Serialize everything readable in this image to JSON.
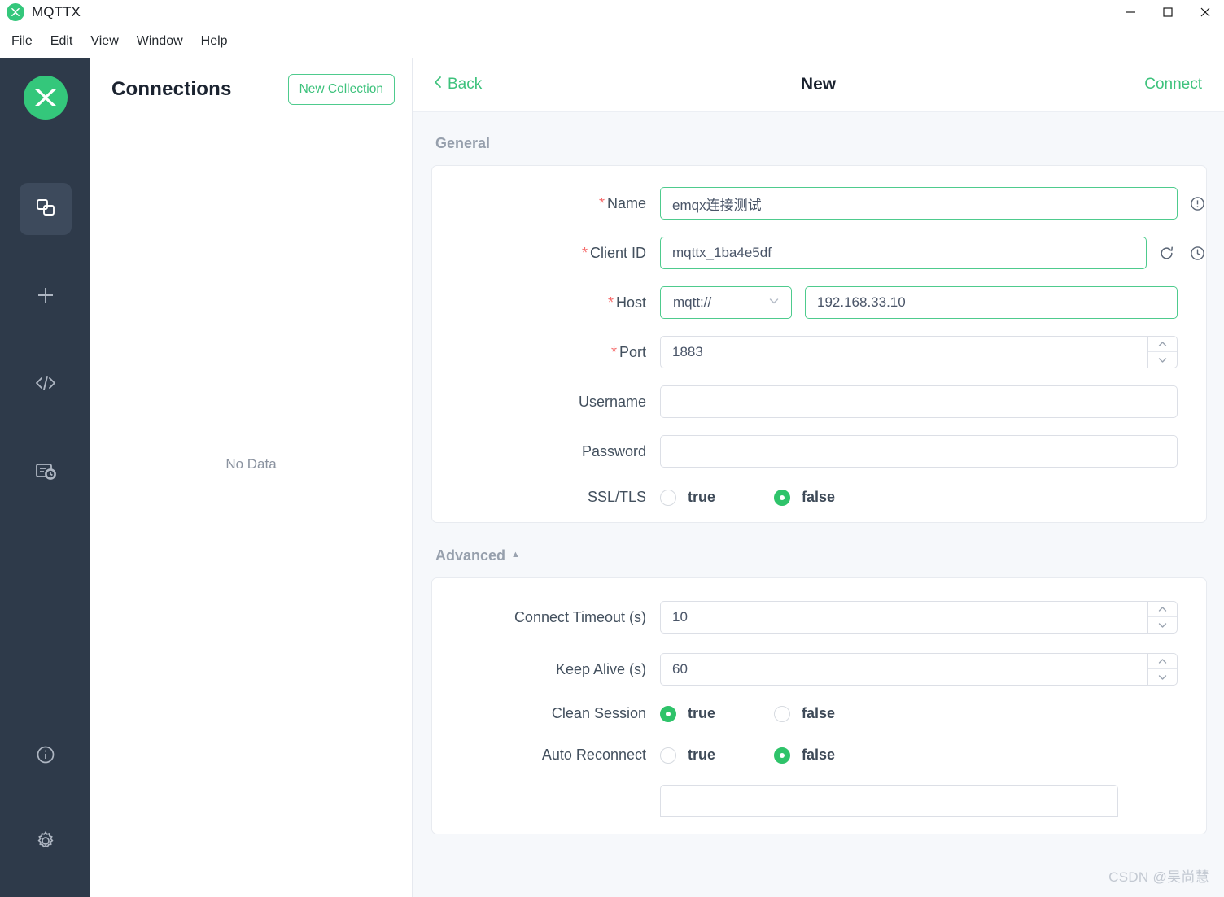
{
  "window": {
    "title": "MQTTX",
    "logo_icon": "mqttx-logo-icon",
    "controls": {
      "minimize": "minimize-icon",
      "maximize": "maximize-icon",
      "close": "close-icon"
    }
  },
  "menubar": {
    "items": [
      {
        "label": "File"
      },
      {
        "label": "Edit"
      },
      {
        "label": "View"
      },
      {
        "label": "Window"
      },
      {
        "label": "Help"
      }
    ]
  },
  "rail": {
    "logo_icon": "mqttx-logo-icon",
    "items": [
      {
        "name": "connections",
        "icon": "connections-icon",
        "active": true
      },
      {
        "name": "new-connection",
        "icon": "plus-icon",
        "active": false
      },
      {
        "name": "scripts",
        "icon": "code-brackets-icon",
        "active": false
      },
      {
        "name": "log",
        "icon": "log-history-icon",
        "active": false
      }
    ],
    "bottom_items": [
      {
        "name": "about",
        "icon": "info-circle-icon"
      },
      {
        "name": "settings",
        "icon": "gear-icon"
      }
    ]
  },
  "connections_panel": {
    "title": "Connections",
    "new_collection_label": "New Collection",
    "empty_text": "No Data"
  },
  "main_header": {
    "back_label": "Back",
    "back_icon": "chevron-left-icon",
    "title": "New",
    "connect_label": "Connect"
  },
  "general": {
    "section_label": "General",
    "fields": {
      "name": {
        "label": "Name",
        "required": true,
        "value": "emqx连接测试",
        "info_icon": "exclamation-circle-icon"
      },
      "client_id": {
        "label": "Client ID",
        "required": true,
        "value": "mqttx_1ba4e5df",
        "refresh_icon": "refresh-icon",
        "history_icon": "clock-icon"
      },
      "host": {
        "label": "Host",
        "required": true,
        "protocol": "mqtt://",
        "protocol_caret_icon": "chevron-down-icon",
        "value": "192.168.33.10",
        "focused": true
      },
      "port": {
        "label": "Port",
        "required": true,
        "value": "1883",
        "stepper_up_icon": "chevron-up-icon",
        "stepper_down_icon": "chevron-down-icon"
      },
      "username": {
        "label": "Username",
        "required": false,
        "value": ""
      },
      "password": {
        "label": "Password",
        "required": false,
        "value": ""
      },
      "ssl_tls": {
        "label": "SSL/TLS",
        "options": [
          {
            "label": "true",
            "selected": false
          },
          {
            "label": "false",
            "selected": true
          }
        ]
      }
    }
  },
  "advanced": {
    "section_label": "Advanced",
    "collapse_caret_icon": "caret-up-icon",
    "fields": {
      "connect_timeout": {
        "label": "Connect Timeout (s)",
        "value": "10"
      },
      "keep_alive": {
        "label": "Keep Alive (s)",
        "value": "60"
      },
      "clean_session": {
        "label": "Clean Session",
        "options": [
          {
            "label": "true",
            "selected": true
          },
          {
            "label": "false",
            "selected": false
          }
        ]
      },
      "auto_reconnect": {
        "label": "Auto Reconnect",
        "options": [
          {
            "label": "true",
            "selected": false
          },
          {
            "label": "false",
            "selected": true
          }
        ]
      }
    }
  },
  "watermark": "CSDN @吴尚慧",
  "colors": {
    "accent_green": "#3dc27c",
    "radio_green": "#2fc36a",
    "rail_bg": "#2e3a4a",
    "rail_active": "#3d4a5c",
    "content_bg": "#f6f8fb",
    "required_red": "#f56c6c"
  }
}
